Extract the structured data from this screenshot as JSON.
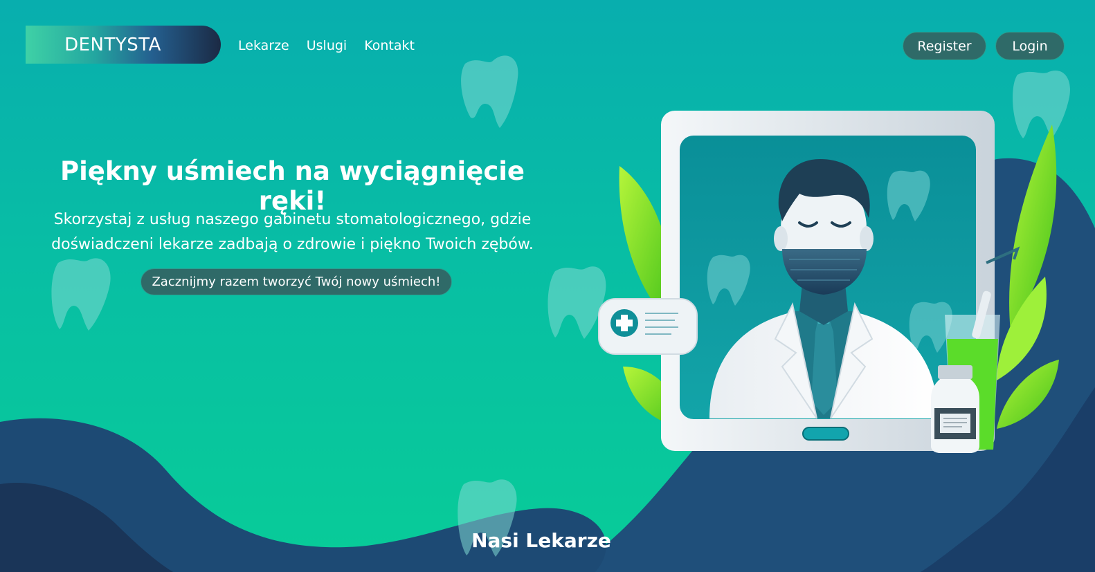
{
  "brand": {
    "name": "DENTYSTA"
  },
  "nav": {
    "items": [
      "Lekarze",
      "Uslugi",
      "Kontakt"
    ]
  },
  "auth": {
    "register_label": "Register",
    "login_label": "Login"
  },
  "hero": {
    "title": "Piękny uśmiech na wyciągnięcie ręki!",
    "description_line1": "Skorzystaj z usług naszego gabinetu stomatologicznego, gdzie",
    "description_line2": "doświadczeni lekarze zadbają o zdrowie i piękno Twoich zębów.",
    "cta_label": "Zacznijmy razem tworzyć Twój nowy uśmiech!"
  },
  "section": {
    "title": "Nasi Lekarze"
  },
  "colors": {
    "background_top": "#08aeae",
    "background_bottom": "#08cc98",
    "button": "#2f6a68",
    "wave_dark": "#1e3f6e",
    "leaf_green": "#8ee11e"
  },
  "icons": [
    "tooth-icon",
    "doctor-illustration",
    "medical-cross-icon",
    "medicine-bottle-icon",
    "leaf-icon"
  ]
}
